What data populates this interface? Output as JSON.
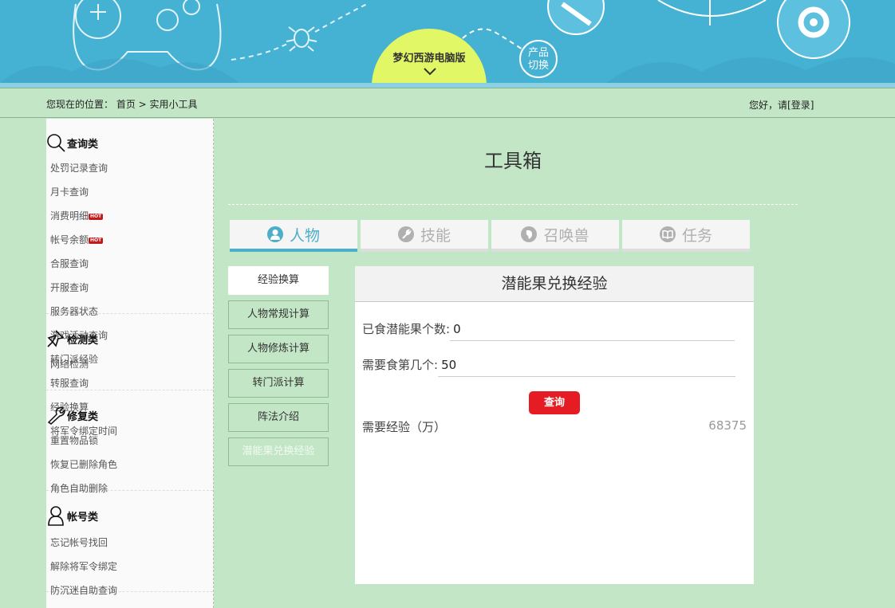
{
  "banner": {
    "product_name": "梦幻西游电脑版",
    "switch_line1": "产品",
    "switch_line2": "切换"
  },
  "breadcrumb": {
    "prefix": "您现在的位置：",
    "home": "首页",
    "separator": " > ",
    "current": "实用小工具"
  },
  "greeting": {
    "text": "您好，请",
    "login": "[登录]"
  },
  "sidebar": {
    "sections": [
      {
        "title": "查询类",
        "icon": "search-icon",
        "links": [
          {
            "label": "处罚记录查询"
          },
          {
            "label": "月卡查询"
          },
          {
            "label": "消费明细",
            "hot": "HOT"
          },
          {
            "label": "帐号余额",
            "hot": "HOT"
          },
          {
            "label": "合服查询"
          },
          {
            "label": "开服查询"
          },
          {
            "label": "服务器状态"
          },
          {
            "label": "游戏活动查询"
          },
          {
            "label": "转门派经验"
          },
          {
            "label": "转服查询"
          },
          {
            "label": "经验换算"
          },
          {
            "label": "将军令绑定时间"
          }
        ]
      },
      {
        "title": "检测类",
        "icon": "pin-icon",
        "links": [
          {
            "label": "网络检测"
          }
        ]
      },
      {
        "title": "修复类",
        "icon": "wrench-icon",
        "links": [
          {
            "label": "重置物品锁"
          },
          {
            "label": "恢复已删除角色"
          },
          {
            "label": "角色自助删除"
          }
        ]
      },
      {
        "title": "帐号类",
        "icon": "user-icon",
        "links": [
          {
            "label": "忘记帐号找回"
          },
          {
            "label": "解除将军令绑定"
          },
          {
            "label": "防沉迷自助查询"
          }
        ]
      }
    ]
  },
  "main": {
    "title": "工具箱",
    "tabs": [
      {
        "label": "人物",
        "icon": "person-icon",
        "active": true
      },
      {
        "label": "技能",
        "icon": "wrench-icon",
        "active": false
      },
      {
        "label": "召唤兽",
        "icon": "paw-icon",
        "active": false
      },
      {
        "label": "任务",
        "icon": "book-icon",
        "active": false
      }
    ],
    "subnav": [
      {
        "label": "经验换算"
      },
      {
        "label": "人物常规计算"
      },
      {
        "label": "人物修炼计算"
      },
      {
        "label": "转门派计算"
      },
      {
        "label": "阵法介绍"
      },
      {
        "label": "潜能果兑换经验"
      }
    ],
    "panel": {
      "title": "潜能果兑换经验",
      "field1_label": "已食潜能果个数:",
      "field1_value": "0",
      "field2_label": "需要食第几个:",
      "field2_value": "50",
      "query_label": "查询",
      "result_label": "需要经验（万）",
      "result_value": "68375"
    }
  },
  "colors": {
    "banner": "#45b2d4",
    "dome": "#e1f766",
    "background": "#c3e6c6",
    "accent": "#4daec9",
    "query_button": "#e51c23"
  }
}
